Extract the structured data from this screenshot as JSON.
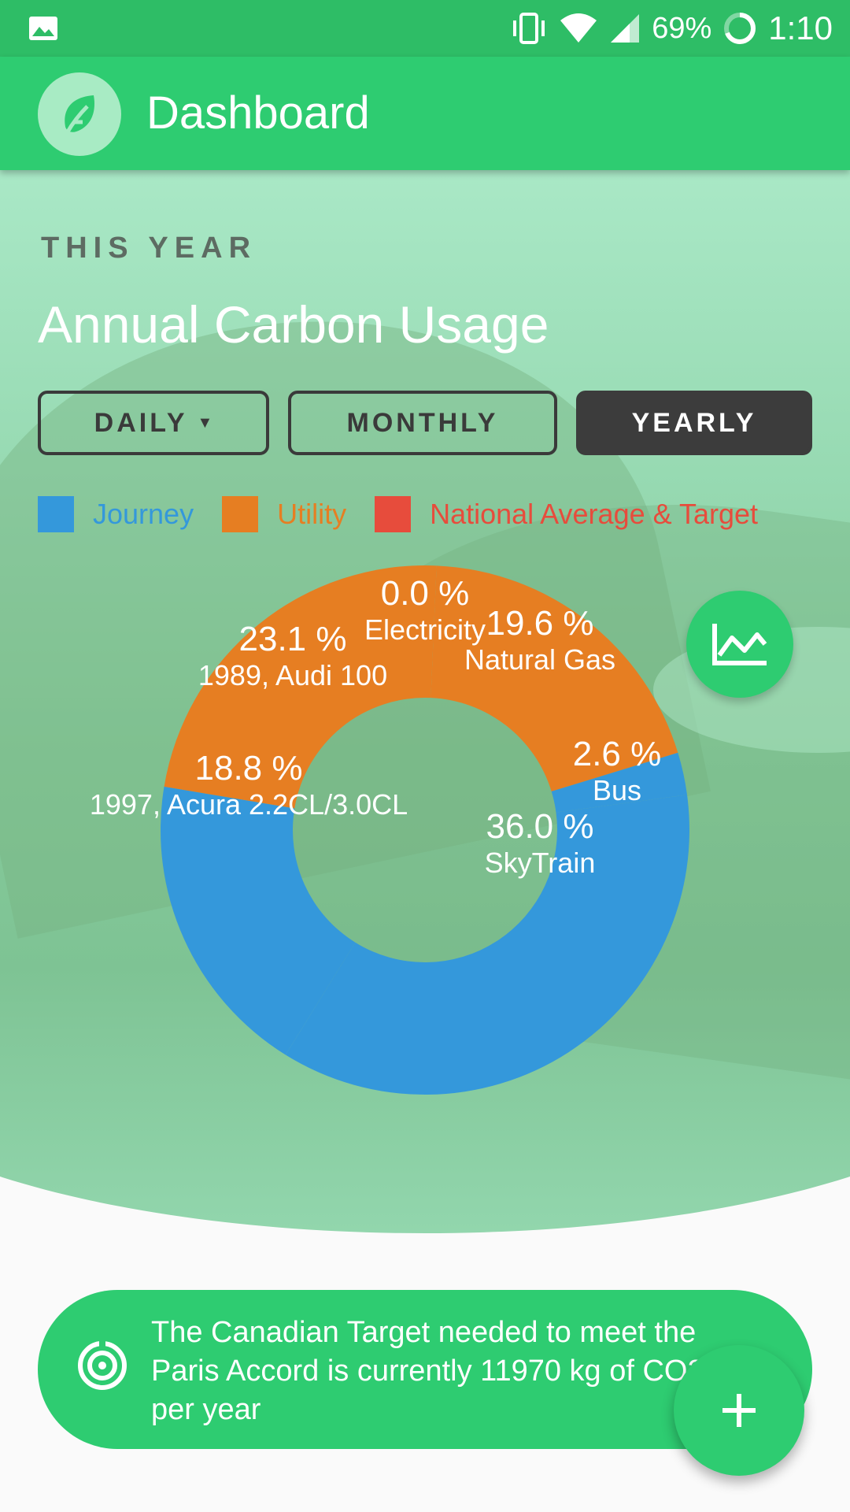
{
  "status_bar": {
    "battery": "69%",
    "time": "1:10",
    "icons": [
      "image-icon",
      "vibrate-icon",
      "wifi-icon",
      "signal-icon",
      "battery-icon"
    ]
  },
  "toolbar": {
    "title": "Dashboard",
    "logo_icon": "leaf-icon"
  },
  "header": {
    "eyebrow": "THIS YEAR",
    "title": "Annual Carbon Usage"
  },
  "range_buttons": [
    {
      "label": "DAILY",
      "has_caret": true,
      "active": false
    },
    {
      "label": "MONTHLY",
      "active": false
    },
    {
      "label": "YEARLY",
      "active": true
    }
  ],
  "legend": [
    {
      "label": "Journey",
      "color": "#3498db"
    },
    {
      "label": "Utility",
      "color": "#e67e22"
    },
    {
      "label": "National Average & Target",
      "color": "#e74c3c"
    }
  ],
  "chart_data": {
    "type": "pie",
    "donut": true,
    "slices": [
      {
        "label": "Bus",
        "percent": "2.6 %",
        "value": 2.6,
        "color": "#3498db"
      },
      {
        "label": "SkyTrain",
        "percent": "36.0 %",
        "value": 36.0,
        "color": "#3498db"
      },
      {
        "label": "1997, Acura 2.2CL/3.0CL",
        "percent": "18.8 %",
        "value": 18.8,
        "color": "#3498db"
      },
      {
        "label": "1989, Audi 100",
        "percent": "23.1 %",
        "value": 23.1,
        "color": "#e67e22"
      },
      {
        "label": "Electricity",
        "percent": "0.0 %",
        "value": 0.0,
        "color": "#e67e22"
      },
      {
        "label": "Natural Gas",
        "percent": "19.6 %",
        "value": 19.6,
        "color": "#e67e22"
      }
    ]
  },
  "chart_toggle_icon": "line-chart-icon",
  "target_banner": {
    "icon": "target-icon",
    "text": "The Canadian Target needed to meet the Paris Accord is currently 11970 kg of CO2 per year"
  },
  "add_button_icon": "plus-icon",
  "colors": {
    "primary": "#2ecc71",
    "primary_dark": "#2ebd66",
    "journey": "#3498db",
    "utility": "#e67e22",
    "national": "#e74c3c"
  }
}
